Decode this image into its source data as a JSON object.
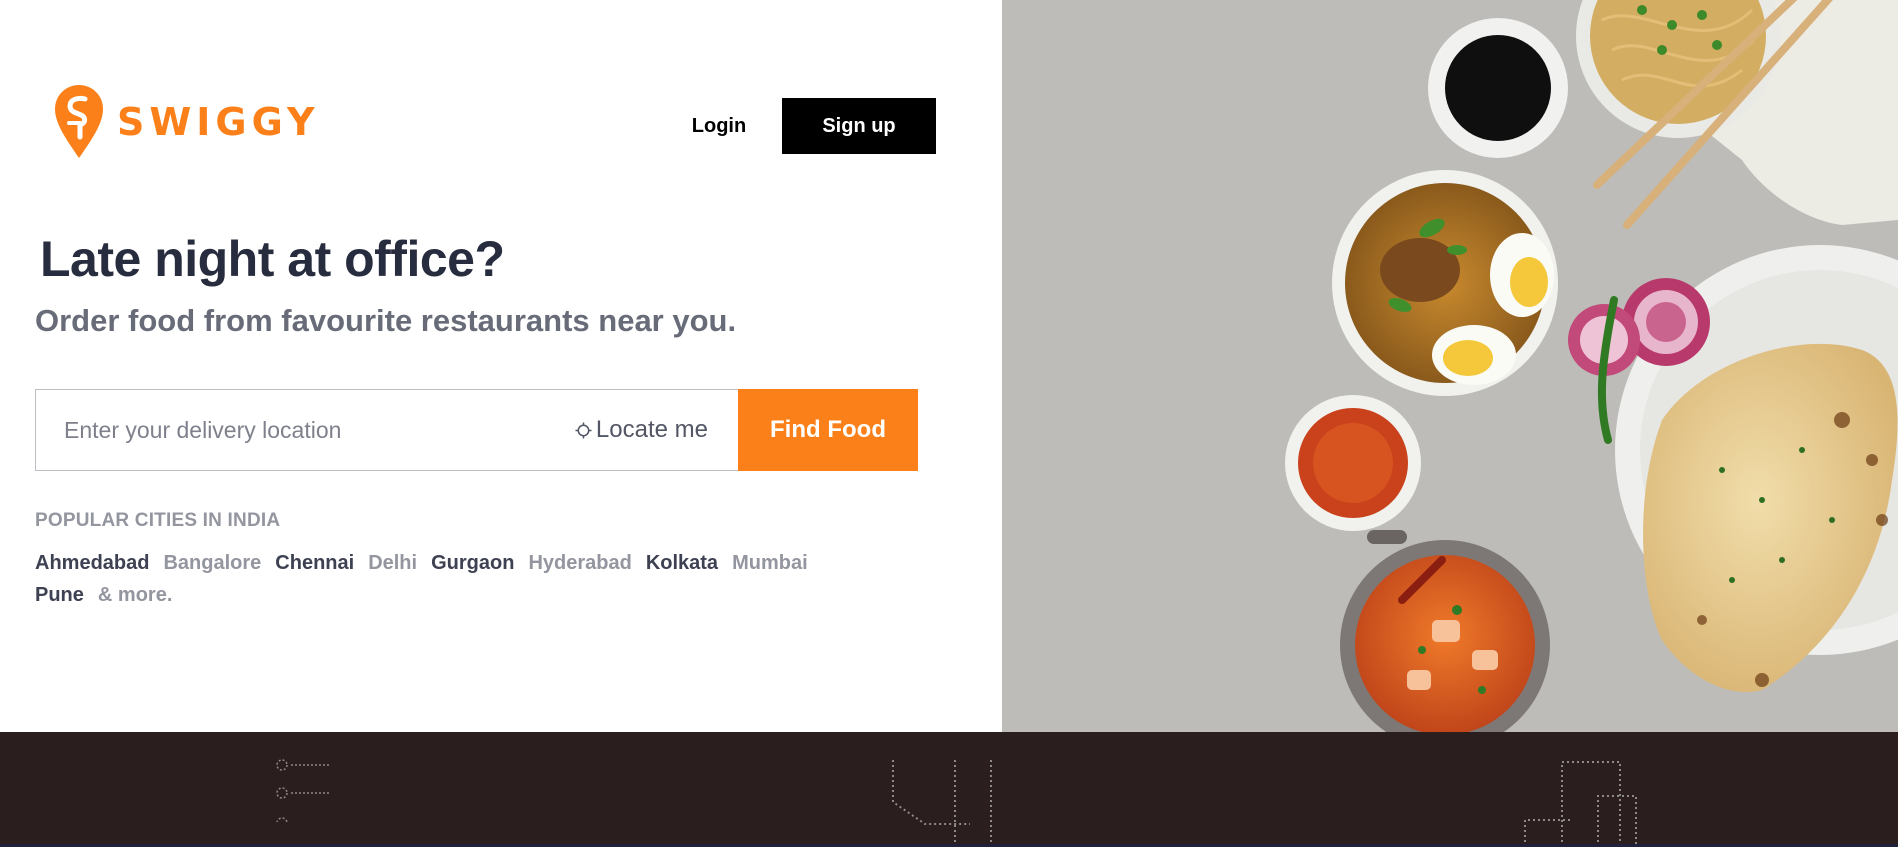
{
  "brand": {
    "name": "SWIGGY",
    "color": "#fc8019"
  },
  "header": {
    "login_label": "Login",
    "signup_label": "Sign up"
  },
  "hero": {
    "headline": "Late night at office?",
    "subheadline": "Order food from favourite restaurants near you."
  },
  "search": {
    "placeholder": "Enter your delivery location",
    "value": "",
    "locate_label": "Locate me",
    "locate_icon": "crosshair-icon",
    "find_label": "Find Food"
  },
  "popular": {
    "title": "POPULAR CITIES IN INDIA",
    "cities": [
      "Ahmedabad",
      "Bangalore",
      "Chennai",
      "Delhi",
      "Gurgaon",
      "Hyderabad",
      "Kolkata",
      "Mumbai",
      "Pune"
    ],
    "more_label": "& more."
  },
  "colors": {
    "accent": "#fc8019",
    "dark_text": "#282c3f",
    "footer_band": "#2b1e1e"
  }
}
